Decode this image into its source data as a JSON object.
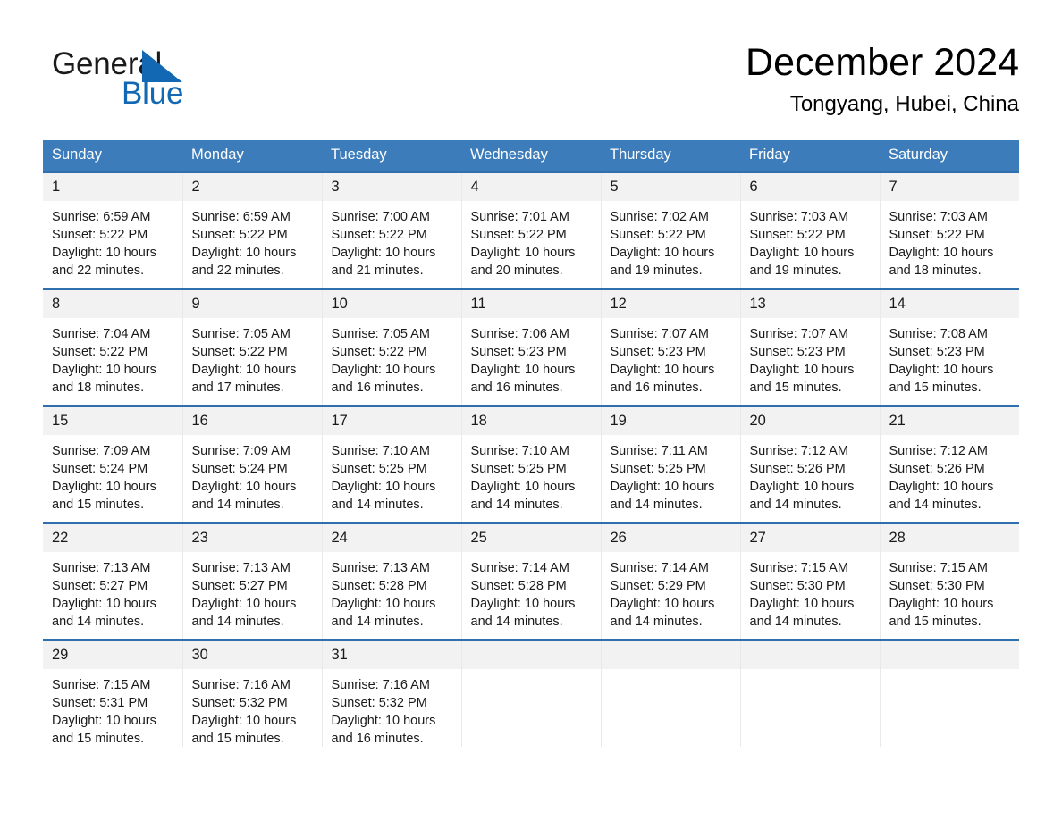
{
  "brand": {
    "name_part1": "General",
    "name_part2": "Blue",
    "logo_icon": "triangle-logo-icon",
    "accent_color": "#1268b3"
  },
  "header": {
    "title": "December 2024",
    "location": "Tongyang, Hubei, China"
  },
  "calendar": {
    "header_bg": "#3d7cba",
    "row_divider_color": "#2f6fae",
    "daynum_bg": "#f2f2f2",
    "weekday_headers": [
      "Sunday",
      "Monday",
      "Tuesday",
      "Wednesday",
      "Thursday",
      "Friday",
      "Saturday"
    ],
    "weeks": [
      [
        {
          "day": "1",
          "sunrise": "Sunrise: 6:59 AM",
          "sunset": "Sunset: 5:22 PM",
          "daylight": "Daylight: 10 hours and 22 minutes."
        },
        {
          "day": "2",
          "sunrise": "Sunrise: 6:59 AM",
          "sunset": "Sunset: 5:22 PM",
          "daylight": "Daylight: 10 hours and 22 minutes."
        },
        {
          "day": "3",
          "sunrise": "Sunrise: 7:00 AM",
          "sunset": "Sunset: 5:22 PM",
          "daylight": "Daylight: 10 hours and 21 minutes."
        },
        {
          "day": "4",
          "sunrise": "Sunrise: 7:01 AM",
          "sunset": "Sunset: 5:22 PM",
          "daylight": "Daylight: 10 hours and 20 minutes."
        },
        {
          "day": "5",
          "sunrise": "Sunrise: 7:02 AM",
          "sunset": "Sunset: 5:22 PM",
          "daylight": "Daylight: 10 hours and 19 minutes."
        },
        {
          "day": "6",
          "sunrise": "Sunrise: 7:03 AM",
          "sunset": "Sunset: 5:22 PM",
          "daylight": "Daylight: 10 hours and 19 minutes."
        },
        {
          "day": "7",
          "sunrise": "Sunrise: 7:03 AM",
          "sunset": "Sunset: 5:22 PM",
          "daylight": "Daylight: 10 hours and 18 minutes."
        }
      ],
      [
        {
          "day": "8",
          "sunrise": "Sunrise: 7:04 AM",
          "sunset": "Sunset: 5:22 PM",
          "daylight": "Daylight: 10 hours and 18 minutes."
        },
        {
          "day": "9",
          "sunrise": "Sunrise: 7:05 AM",
          "sunset": "Sunset: 5:22 PM",
          "daylight": "Daylight: 10 hours and 17 minutes."
        },
        {
          "day": "10",
          "sunrise": "Sunrise: 7:05 AM",
          "sunset": "Sunset: 5:22 PM",
          "daylight": "Daylight: 10 hours and 16 minutes."
        },
        {
          "day": "11",
          "sunrise": "Sunrise: 7:06 AM",
          "sunset": "Sunset: 5:23 PM",
          "daylight": "Daylight: 10 hours and 16 minutes."
        },
        {
          "day": "12",
          "sunrise": "Sunrise: 7:07 AM",
          "sunset": "Sunset: 5:23 PM",
          "daylight": "Daylight: 10 hours and 16 minutes."
        },
        {
          "day": "13",
          "sunrise": "Sunrise: 7:07 AM",
          "sunset": "Sunset: 5:23 PM",
          "daylight": "Daylight: 10 hours and 15 minutes."
        },
        {
          "day": "14",
          "sunrise": "Sunrise: 7:08 AM",
          "sunset": "Sunset: 5:23 PM",
          "daylight": "Daylight: 10 hours and 15 minutes."
        }
      ],
      [
        {
          "day": "15",
          "sunrise": "Sunrise: 7:09 AM",
          "sunset": "Sunset: 5:24 PM",
          "daylight": "Daylight: 10 hours and 15 minutes."
        },
        {
          "day": "16",
          "sunrise": "Sunrise: 7:09 AM",
          "sunset": "Sunset: 5:24 PM",
          "daylight": "Daylight: 10 hours and 14 minutes."
        },
        {
          "day": "17",
          "sunrise": "Sunrise: 7:10 AM",
          "sunset": "Sunset: 5:25 PM",
          "daylight": "Daylight: 10 hours and 14 minutes."
        },
        {
          "day": "18",
          "sunrise": "Sunrise: 7:10 AM",
          "sunset": "Sunset: 5:25 PM",
          "daylight": "Daylight: 10 hours and 14 minutes."
        },
        {
          "day": "19",
          "sunrise": "Sunrise: 7:11 AM",
          "sunset": "Sunset: 5:25 PM",
          "daylight": "Daylight: 10 hours and 14 minutes."
        },
        {
          "day": "20",
          "sunrise": "Sunrise: 7:12 AM",
          "sunset": "Sunset: 5:26 PM",
          "daylight": "Daylight: 10 hours and 14 minutes."
        },
        {
          "day": "21",
          "sunrise": "Sunrise: 7:12 AM",
          "sunset": "Sunset: 5:26 PM",
          "daylight": "Daylight: 10 hours and 14 minutes."
        }
      ],
      [
        {
          "day": "22",
          "sunrise": "Sunrise: 7:13 AM",
          "sunset": "Sunset: 5:27 PM",
          "daylight": "Daylight: 10 hours and 14 minutes."
        },
        {
          "day": "23",
          "sunrise": "Sunrise: 7:13 AM",
          "sunset": "Sunset: 5:27 PM",
          "daylight": "Daylight: 10 hours and 14 minutes."
        },
        {
          "day": "24",
          "sunrise": "Sunrise: 7:13 AM",
          "sunset": "Sunset: 5:28 PM",
          "daylight": "Daylight: 10 hours and 14 minutes."
        },
        {
          "day": "25",
          "sunrise": "Sunrise: 7:14 AM",
          "sunset": "Sunset: 5:28 PM",
          "daylight": "Daylight: 10 hours and 14 minutes."
        },
        {
          "day": "26",
          "sunrise": "Sunrise: 7:14 AM",
          "sunset": "Sunset: 5:29 PM",
          "daylight": "Daylight: 10 hours and 14 minutes."
        },
        {
          "day": "27",
          "sunrise": "Sunrise: 7:15 AM",
          "sunset": "Sunset: 5:30 PM",
          "daylight": "Daylight: 10 hours and 14 minutes."
        },
        {
          "day": "28",
          "sunrise": "Sunrise: 7:15 AM",
          "sunset": "Sunset: 5:30 PM",
          "daylight": "Daylight: 10 hours and 15 minutes."
        }
      ],
      [
        {
          "day": "29",
          "sunrise": "Sunrise: 7:15 AM",
          "sunset": "Sunset: 5:31 PM",
          "daylight": "Daylight: 10 hours and 15 minutes."
        },
        {
          "day": "30",
          "sunrise": "Sunrise: 7:16 AM",
          "sunset": "Sunset: 5:32 PM",
          "daylight": "Daylight: 10 hours and 15 minutes."
        },
        {
          "day": "31",
          "sunrise": "Sunrise: 7:16 AM",
          "sunset": "Sunset: 5:32 PM",
          "daylight": "Daylight: 10 hours and 16 minutes."
        },
        {
          "day": "",
          "sunrise": "",
          "sunset": "",
          "daylight": ""
        },
        {
          "day": "",
          "sunrise": "",
          "sunset": "",
          "daylight": ""
        },
        {
          "day": "",
          "sunrise": "",
          "sunset": "",
          "daylight": ""
        },
        {
          "day": "",
          "sunrise": "",
          "sunset": "",
          "daylight": ""
        }
      ]
    ]
  }
}
